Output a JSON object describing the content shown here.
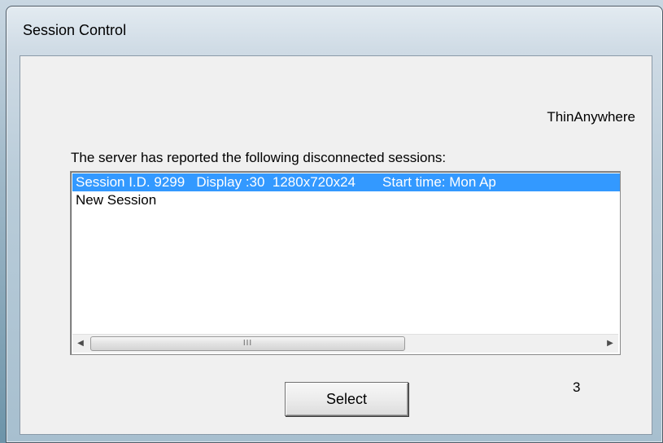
{
  "window": {
    "title": "Session Control"
  },
  "dialog": {
    "brand": "ThinAnywhere",
    "prompt": "The server has reported the following disconnected sessions:",
    "sessions": [
      {
        "label": "Session I.D. 9299   Display :30  1280x720x24       Start time: Mon Ap",
        "selected": true
      },
      {
        "label": "New Session",
        "selected": false
      }
    ],
    "select_label": "Select",
    "counter": "3"
  },
  "scrollbar": {
    "left_arrow_icon": "chevron-left-icon",
    "right_arrow_icon": "chevron-right-icon",
    "grip": "III"
  },
  "colors": {
    "selection": "#3399ff",
    "dialog_background": "#f0f0f0"
  }
}
